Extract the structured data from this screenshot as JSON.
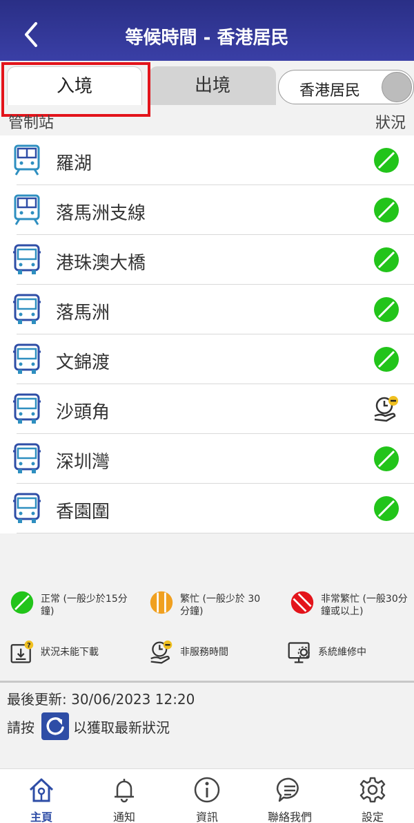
{
  "header": {
    "title": "等候時間 - 香港居民"
  },
  "tabs": {
    "inbound": "入境",
    "outbound": "出境"
  },
  "toggle": {
    "label": "香港居民"
  },
  "columns": {
    "control_point": "管制站",
    "status": "狀況"
  },
  "checkpoints": [
    {
      "name": "羅湖",
      "icon": "train-icon",
      "status": "normal"
    },
    {
      "name": "落馬洲支線",
      "icon": "train-icon",
      "status": "normal"
    },
    {
      "name": "港珠澳大橋",
      "icon": "bus-icon",
      "status": "normal"
    },
    {
      "name": "落馬洲",
      "icon": "bus-icon",
      "status": "normal"
    },
    {
      "name": "文錦渡",
      "icon": "bus-icon",
      "status": "normal"
    },
    {
      "name": "沙頭角",
      "icon": "bus-icon",
      "status": "non-service-hours"
    },
    {
      "name": "深圳灣",
      "icon": "bus-icon",
      "status": "normal"
    },
    {
      "name": "香園圍",
      "icon": "bus-icon",
      "status": "normal"
    }
  ],
  "legend": {
    "normal": "正常 (一般少於15分鐘)",
    "busy": "繁忙 (一般少於 30 分鐘)",
    "very_busy": "非常繁忙 (一般30分鐘或以上)",
    "unavailable": "狀況未能下載",
    "non_service": "非服務時間",
    "maintenance": "系統維修中"
  },
  "update": {
    "label": "最後更新:",
    "time": "30/06/2023 12:20",
    "prompt_before": "請按",
    "prompt_after": "以獲取最新狀況"
  },
  "nav": [
    {
      "label": "主頁",
      "icon": "home-icon"
    },
    {
      "label": "通知",
      "icon": "bell-icon"
    },
    {
      "label": "資訊",
      "icon": "info-icon"
    },
    {
      "label": "聯絡我們",
      "icon": "chat-icon"
    },
    {
      "label": "設定",
      "icon": "gear-icon"
    }
  ],
  "colors": {
    "header": "#2a2f86",
    "normal": "#22c41a",
    "busy": "#f0a020",
    "very_busy": "#e3141b",
    "accent": "#2e4da6",
    "highlight": "#e3141b"
  }
}
